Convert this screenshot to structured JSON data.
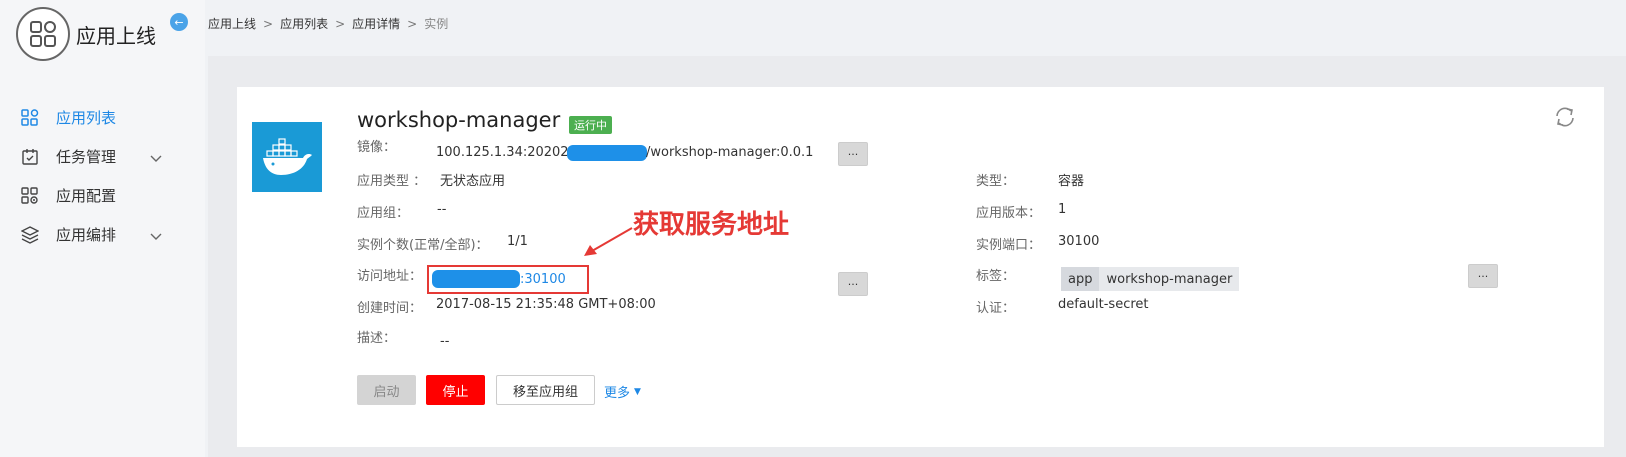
{
  "app_header": {
    "title": "应用上线"
  },
  "sidebar": {
    "items": [
      {
        "label": "应用列表",
        "icon": "app-list-icon",
        "active": true
      },
      {
        "label": "任务管理",
        "icon": "task-icon",
        "expandable": true
      },
      {
        "label": "应用配置",
        "icon": "config-icon"
      },
      {
        "label": "应用编排",
        "icon": "layers-icon",
        "expandable": true
      }
    ]
  },
  "breadcrumb": [
    "应用上线",
    "应用列表",
    "应用详情",
    "实例"
  ],
  "app": {
    "name": "workshop-manager",
    "status": "运行中",
    "image_label": "镜像：",
    "image_prefix": "100.125.1.34:20202/",
    "image_suffix": "/workshop-manager:0.0.1",
    "type_label": "应用类型 ：",
    "type_value": "无状态应用",
    "group_label": "应用组：",
    "group_value": "--",
    "instances_label": "实例个数(正常/全部)：",
    "instances_value": "1/1",
    "access_label": "访问地址：",
    "access_suffix": ":30100",
    "created_label": "创建时间：",
    "created_value": "2017-08-15 21:35:48 GMT+08:00",
    "desc_label": "描述：",
    "desc_value": "--",
    "kind_label": "类型：",
    "kind_value": "容器",
    "version_label": "应用版本：",
    "version_value": "1",
    "port_label": "实例端口：",
    "port_value": "30100",
    "tag_label": "标签：",
    "tag_key": "app",
    "tag_value": "workshop-manager",
    "auth_label": "认证：",
    "auth_value": "default-secret",
    "more_dots": "···"
  },
  "annotation": "获取服务地址",
  "actions": {
    "start": "启动",
    "stop": "停止",
    "move": "移至应用组",
    "more": "更多"
  },
  "colors": {
    "accent": "#1e88e5",
    "status_green": "#4caf50",
    "danger": "#ff0000",
    "annotation_red": "#e53935",
    "docker_blue": "#1a9ad6"
  }
}
